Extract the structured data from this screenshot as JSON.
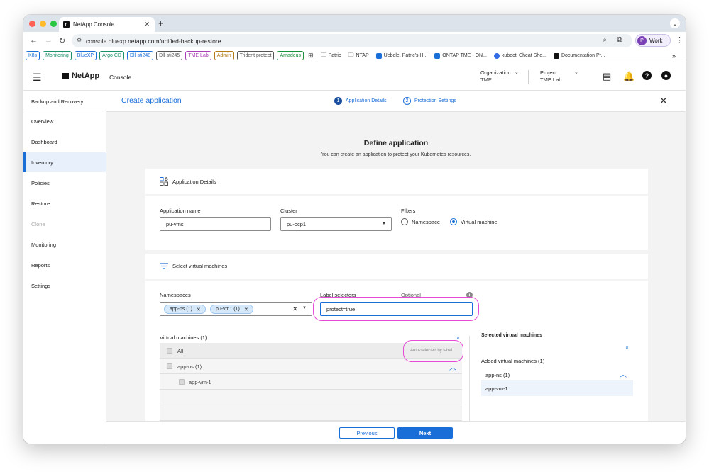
{
  "browser": {
    "tab_title": "NetApp Console",
    "url": "console.bluexp.netapp.com/unified-backup-restore",
    "profile_label": "Work",
    "profile_initial": "P",
    "bookmarks_chips": [
      {
        "label": "K8s",
        "color": "#1a6ed8"
      },
      {
        "label": "Monitoring",
        "color": "#1a8f6a"
      },
      {
        "label": "BlueXP",
        "color": "#1a6ed8"
      },
      {
        "label": "Argo CD",
        "color": "#1a8f6a"
      },
      {
        "label": "Dll-sti248",
        "color": "#1a6ed8"
      },
      {
        "label": "Dll-sti245",
        "color": "#555555"
      },
      {
        "label": "TME Lab",
        "color": "#a83fb4"
      },
      {
        "label": "Admin",
        "color": "#b07a1a"
      },
      {
        "label": "Trident protect",
        "color": "#555555"
      },
      {
        "label": "Amadeus",
        "color": "#1a8f3a"
      }
    ],
    "bookmarks": [
      "Patric",
      "NTAP",
      "Uebele, Patric's H...",
      "ONTAP TME - ON...",
      "kubectl Cheat She...",
      "Documentation Pr..."
    ],
    "overflow": "»"
  },
  "header": {
    "brand": "NetApp",
    "product": "Console",
    "org_label": "Organization",
    "org_value": "TME",
    "project_label": "Project",
    "project_value": "TME Lab"
  },
  "sidebar": {
    "title": "Backup and Recovery",
    "items": [
      "Overview",
      "Dashboard",
      "Inventory",
      "Policies",
      "Restore",
      "Clone",
      "Monitoring",
      "Reports",
      "Settings"
    ]
  },
  "wizard": {
    "title": "Create application",
    "step1": "Application Details",
    "step1_num": "1",
    "step2": "Protection Settings",
    "step2_num": "2",
    "heading": "Define application",
    "subheading": "You can create an application to protect your Kubernetes resources."
  },
  "details": {
    "section_title": "Application Details",
    "app_name_label": "Application name",
    "app_name_value": "pu-vms",
    "cluster_label": "Cluster",
    "cluster_value": "pu-ocp1",
    "filters_label": "Filters",
    "filter_namespace": "Namespace",
    "filter_vm": "Virtual machine"
  },
  "select_vms": {
    "section_title": "Select virtual machines",
    "namespaces_label": "Namespaces",
    "namespace_tags": [
      "app-ns (1)",
      "pu-vm1 (1)"
    ],
    "label_selectors_label": "Label selectors",
    "optional": "Optional",
    "label_selector_value": "protect=true",
    "vm_list_title": "Virtual machines (1)",
    "all_label": "All",
    "auto_selected": "Auto-selected by label",
    "group_label": "app-ns (1)",
    "vm_label": "app-vm-1",
    "selected_title": "Selected virtual machines",
    "added_title": "Added virtual machines (1)",
    "added_group": "app-ns (1)",
    "added_vm": "app-vm-1"
  },
  "footer": {
    "previous": "Previous",
    "next": "Next"
  }
}
